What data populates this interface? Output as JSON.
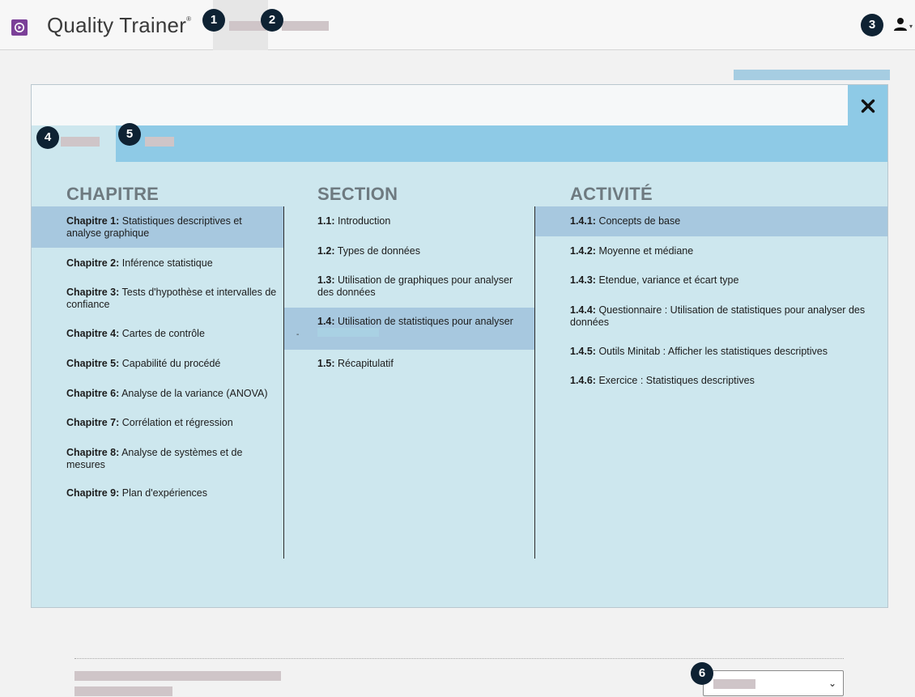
{
  "header": {
    "app_title": "Quality Trainer",
    "app_title_mark": "®",
    "badges": [
      "1",
      "2",
      "3",
      "4",
      "5",
      "6"
    ]
  },
  "modal": {
    "close_symbol": "✕",
    "columns": {
      "chapter_heading": "CHAPITRE",
      "section_heading": "SECTION",
      "activity_heading": "ACTIVITÉ"
    },
    "chapters": [
      {
        "num": "Chapitre 1:",
        "text": " Statistiques descriptives et analyse graphique",
        "selected": true
      },
      {
        "num": "Chapitre 2:",
        "text": " Inférence statistique"
      },
      {
        "num": "Chapitre 3:",
        "text": " Tests d'hypothèse et intervalles de confiance"
      },
      {
        "num": "Chapitre 4:",
        "text": " Cartes de contrôle"
      },
      {
        "num": "Chapitre 5:",
        "text": " Capabilité du procédé"
      },
      {
        "num": "Chapitre 6:",
        "text": " Analyse de la variance (ANOVA)"
      },
      {
        "num": "Chapitre 7:",
        "text": " Corrélation et régression"
      },
      {
        "num": "Chapitre 8:",
        "text": " Analyse de systèmes et de mesures"
      },
      {
        "num": "Chapitre 9:",
        "text": " Plan d'expériences"
      }
    ],
    "sections": [
      {
        "num": "1.1:",
        "text": " Introduction"
      },
      {
        "num": "1.2:",
        "text": " Types de données"
      },
      {
        "num": "1.3:",
        "text": " Utilisation de graphiques pour analyser des données"
      },
      {
        "num": "1.4:",
        "text": " Utilisation de statistiques pour analyser",
        "selected": true
      },
      {
        "num": "1.5:",
        "text": " Récapitulatif"
      }
    ],
    "section_marker": "-",
    "activities": [
      {
        "num": "1.4.1:",
        "text": " Concepts de base",
        "selected": true
      },
      {
        "num": "1.4.2:",
        "text": " Moyenne et médiane"
      },
      {
        "num": "1.4.3:",
        "text": " Etendue, variance et écart type"
      },
      {
        "num": "1.4.4:",
        "text": " Questionnaire : Utilisation de statistiques pour analyser des données"
      },
      {
        "num": "1.4.5:",
        "text": " Outils Minitab : Afficher les statistiques descriptives"
      },
      {
        "num": "1.4.6:",
        "text": " Exercice : Statistiques descriptives"
      }
    ]
  },
  "footer": {
    "select_chevron": "⌄"
  },
  "colors": {
    "accent_blue": "#8ecae6",
    "panel_bg": "#cde7ee",
    "selected_row": "#a7c8df",
    "badge_bg": "#0e2233",
    "logo_purple": "#7b3f98"
  }
}
